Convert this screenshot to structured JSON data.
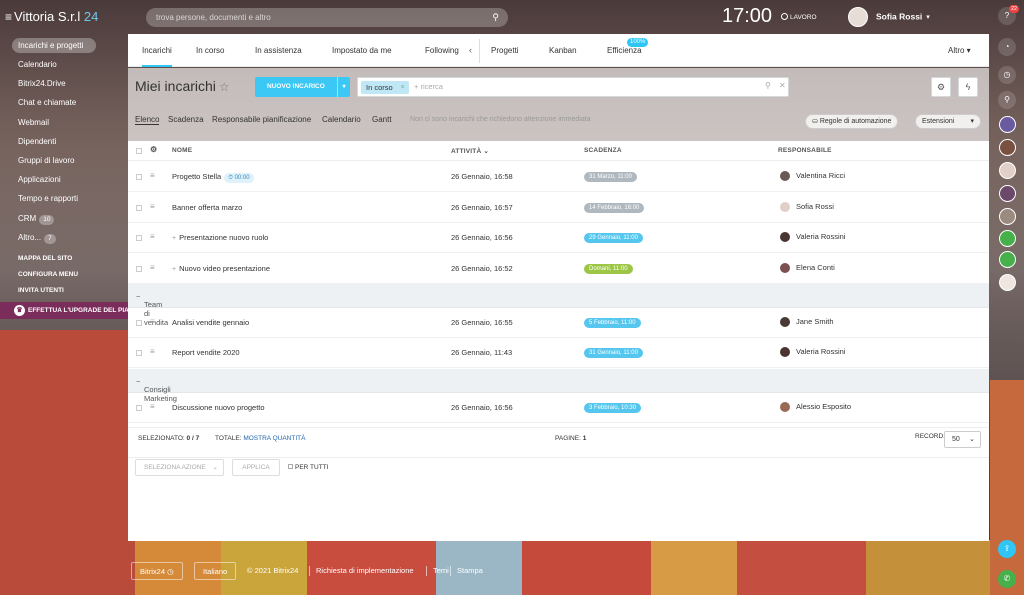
{
  "topbar": {
    "company": "Vittoria S.r.l",
    "brand_num": "24",
    "search_placeholder": "trova persone, documenti e altro",
    "time": "17:00",
    "work_status": "LAVORO",
    "user_name": "Sofia Rossi"
  },
  "sidebar": {
    "items": [
      {
        "label": "Incarichi e progetti",
        "active": true
      },
      {
        "label": "Calendario"
      },
      {
        "label": "Bitrix24.Drive"
      },
      {
        "label": "Chat e chiamate"
      },
      {
        "label": "Webmail"
      },
      {
        "label": "Dipendenti"
      },
      {
        "label": "Gruppi di lavoro"
      },
      {
        "label": "Applicazioni"
      },
      {
        "label": "Tempo e rapporti"
      },
      {
        "label": "CRM",
        "badge": "10"
      },
      {
        "label": "Altro...",
        "badge": "7"
      }
    ],
    "links": [
      "MAPPA DEL SITO",
      "CONFIGURA MENU",
      "INVITA UTENTI"
    ],
    "upgrade": "EFFETTUA L'UPGRADE DEL PIANO"
  },
  "rightbar": {
    "notif_count": "22"
  },
  "tabs": [
    {
      "label": "Incarichi",
      "active": true
    },
    {
      "label": "In corso"
    },
    {
      "label": "In assistenza"
    },
    {
      "label": "Impostato da me"
    },
    {
      "label": "Following"
    },
    {
      "label": "Progetti"
    },
    {
      "label": "Kanban"
    },
    {
      "label": "Efficienza",
      "badge": "100%"
    },
    {
      "label": "Altro"
    }
  ],
  "page": {
    "title": "Miei incarichi",
    "new_button": "NUOVO INCARICO",
    "filter_chip": "In corso",
    "filter_placeholder": "+ ricerca"
  },
  "subnav": {
    "views": [
      "Elenco",
      "Scadenza",
      "Responsabile pianificazione",
      "Calendario",
      "Gantt"
    ],
    "note": "Non ci sono incarichi che richiedono attenzione immediata",
    "automation": "Regole di automazione",
    "extensions": "Estensioni"
  },
  "table": {
    "headers": {
      "name": "NOME",
      "activity": "ATTIVITÀ",
      "deadline": "SCADENZA",
      "responsible": "RESPONSABILE"
    },
    "rows": [
      {
        "name": "Progetto Stella",
        "timer": "00:00",
        "activity": "26 Gennaio, 16:58",
        "deadline": "31 Marzo, 11:00",
        "deadline_color": "#b0b8bf",
        "resp": "Valentina Ricci",
        "avatar_color": "#6a5a55"
      },
      {
        "name": "Banner offerta marzo",
        "activity": "26 Gennaio, 16:57",
        "deadline": "14 Febbraio, 16:00",
        "deadline_color": "#b0b8bf",
        "resp": "Sofia Rossi",
        "avatar_color": "#e0cfc8"
      },
      {
        "name": "Presentazione nuovo ruolo",
        "plus": true,
        "activity": "26 Gennaio, 16:56",
        "deadline": "29 Gennaio, 11:00",
        "deadline_color": "#55c6ee",
        "resp": "Valeria Rossini",
        "avatar_color": "#4a3530"
      },
      {
        "name": "Nuovo video presentazione",
        "plus": true,
        "activity": "26 Gennaio, 16:52",
        "deadline": "Domani, 11:00",
        "deadline_color": "#9dc646",
        "resp": "Elena Conti",
        "avatar_color": "#7a5050"
      }
    ],
    "group1": "Team di vendita",
    "rows2": [
      {
        "name": "Analisi vendite gennaio",
        "activity": "26 Gennaio, 16:55",
        "deadline": "5 Febbraio, 11:00",
        "deadline_color": "#55c6ee",
        "resp": "Jane Smith",
        "avatar_color": "#4a3a35"
      },
      {
        "name": "Report vendite 2020",
        "activity": "26 Gennaio, 11:43",
        "deadline": "31 Gennaio, 11:00",
        "deadline_color": "#55c6ee",
        "resp": "Valeria Rossini",
        "avatar_color": "#4a3530"
      }
    ],
    "group2": "Consigli Marketing",
    "rows3": [
      {
        "name": "Discussione nuovo progetto",
        "activity": "26 Gennaio, 16:56",
        "deadline": "3 Febbraio, 10:30",
        "deadline_color": "#55c6ee",
        "resp": "Alessio Esposito",
        "avatar_color": "#9a6a55"
      }
    ]
  },
  "footer": {
    "selected_label": "SELEZIONATO:",
    "selected_value": "0 / 7",
    "total_label": "TOTALE:",
    "total_link": "MOSTRA QUANTITÀ",
    "pages_label": "PAGINE:",
    "pages_value": "1",
    "records_label": "RECORD:",
    "records_value": "50",
    "action_select": "SELEZIONA AZIONE",
    "apply": "APPLICA",
    "for_all": "PER TUTTI"
  },
  "bottom": {
    "brand": "Bitrix24",
    "language": "Italiano",
    "copyright": "© 2021 Bitrix24",
    "request": "Richiesta di implementazione",
    "themes": "Temi",
    "print": "Stampa"
  }
}
